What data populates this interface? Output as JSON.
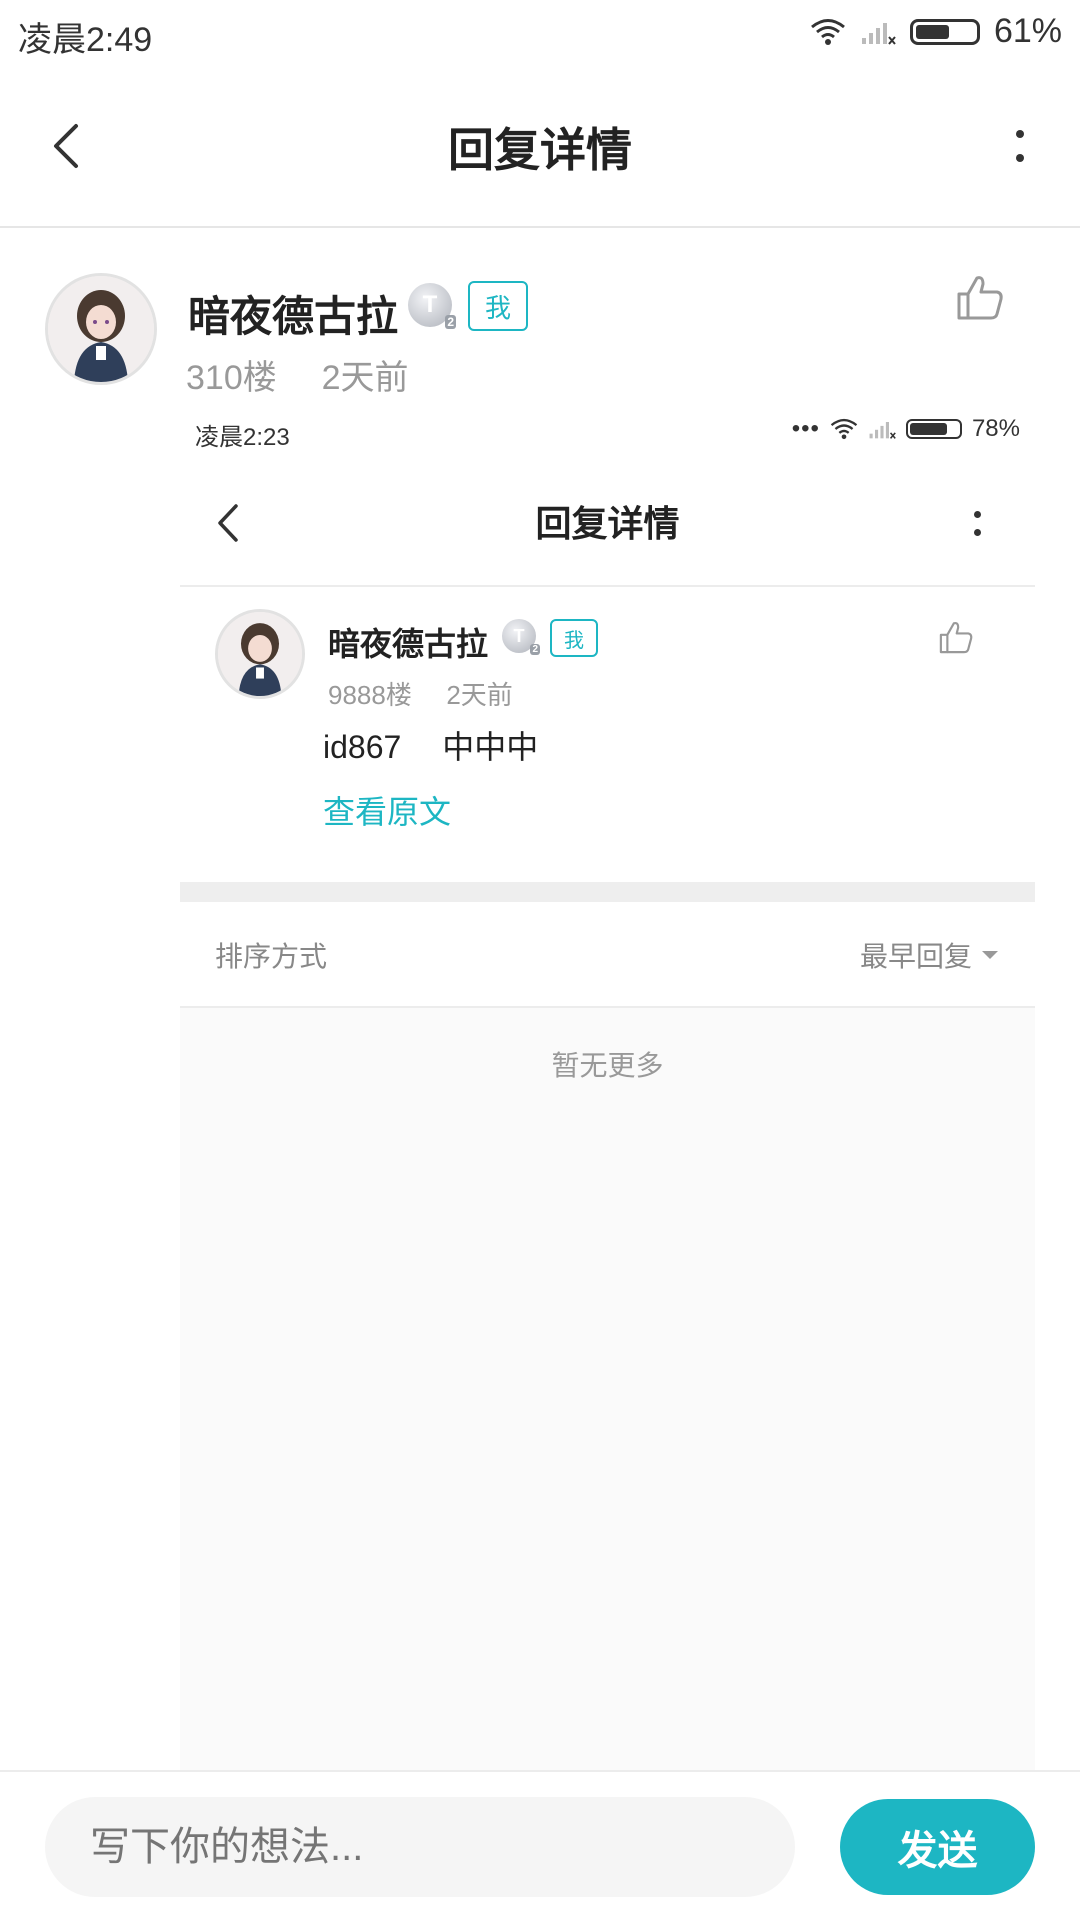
{
  "status_bar": {
    "time": "凌晨2:49",
    "battery": "61%",
    "battery_level": 0.61
  },
  "header": {
    "title": "回复详情"
  },
  "post": {
    "username": "暗夜德古拉",
    "level_badge": "T",
    "level_sub": "2",
    "me_tag": "我",
    "floor": "310楼",
    "time": "2天前"
  },
  "embedded": {
    "status_time": "凌晨2:23",
    "status_battery": "78%",
    "battery_level": 0.78,
    "title": "回复详情",
    "username": "暗夜德古拉",
    "level_badge": "T",
    "level_sub": "2",
    "me_tag": "我",
    "floor": "9888楼",
    "time": "2天前",
    "content": "id867　 中中中",
    "view_original": "查看原文",
    "sort_label": "排序方式",
    "sort_value": "最早回复",
    "empty_text": "暂无更多"
  },
  "composer": {
    "placeholder": "写下你的想法...",
    "send_label": "发送"
  },
  "colors": {
    "accent": "#1db6c3"
  },
  "icons": [
    "back-arrow-icon",
    "more-vertical-icon",
    "thumbs-up-icon",
    "wifi-icon",
    "signal-icon",
    "battery-icon",
    "caret-down-icon"
  ]
}
